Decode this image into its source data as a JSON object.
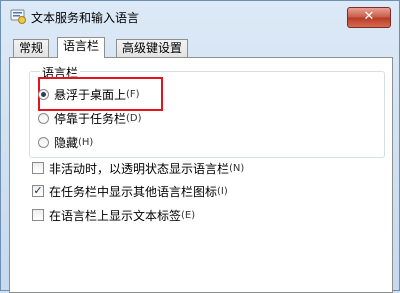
{
  "window": {
    "title": "文本服务和输入语言",
    "close_label": "✕"
  },
  "tabs": [
    {
      "label": "常规",
      "active": false
    },
    {
      "label": "语言栏",
      "active": true
    },
    {
      "label": "高级键设置",
      "active": false
    }
  ],
  "language_bar": {
    "group_label": "语言栏",
    "options": [
      {
        "label": "悬浮于桌面上",
        "hotkey": "(F)",
        "selected": true
      },
      {
        "label": "停靠于任务栏",
        "hotkey": "(D)",
        "selected": false
      },
      {
        "label": "隐藏",
        "hotkey": "(H)",
        "selected": false
      }
    ]
  },
  "checkboxes": [
    {
      "label": "非活动时，以透明状态显示语言栏",
      "hotkey": "(N)",
      "checked": false
    },
    {
      "label": "在任务栏中显示其他语言栏图标",
      "hotkey": "(I)",
      "checked": true
    },
    {
      "label": "在语言栏上显示文本标签",
      "hotkey": "(E)",
      "checked": false
    }
  ],
  "colors": {
    "highlight": "#e0151f",
    "close_button": "#c75a45"
  }
}
